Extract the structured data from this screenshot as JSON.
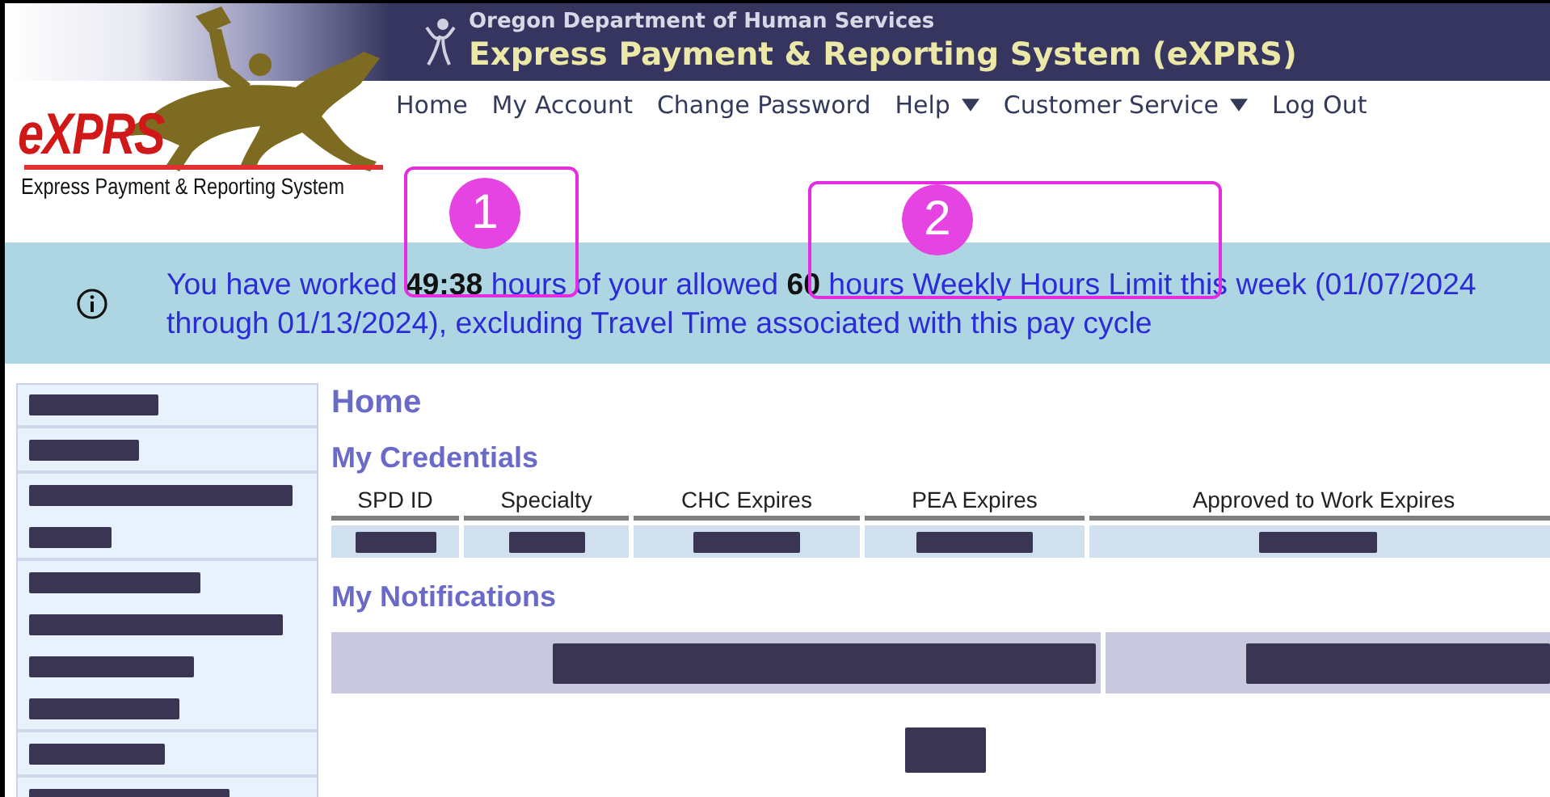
{
  "header": {
    "agency": "Oregon Department of Human Services",
    "system_title": "Express Payment & Reporting System (eXPRS)"
  },
  "logo": {
    "wordmark": "eXPRS",
    "tagline": "Express Payment & Reporting System"
  },
  "nav": [
    {
      "label": "Home",
      "kind": "link"
    },
    {
      "label": "My Account",
      "kind": "link"
    },
    {
      "label": "Change Password",
      "kind": "link"
    },
    {
      "label": "Help",
      "kind": "menu"
    },
    {
      "label": "Customer Service",
      "kind": "menu"
    },
    {
      "label": "Log Out",
      "kind": "link"
    }
  ],
  "annotations": [
    {
      "number": "1"
    },
    {
      "number": "2"
    }
  ],
  "banner": {
    "message": "You have worked **49:38** hours of your allowed **60** hours Weekly Hours Limit this week (01/07/2024 through 01/13/2024), excluding Travel Time associated with this pay cycle"
  },
  "sidebar": {
    "groups": [
      {
        "items": [
          {
            "kind": "redacted"
          }
        ]
      },
      {
        "items": [
          {
            "kind": "redacted"
          }
        ]
      },
      {
        "items": [
          {
            "kind": "redacted"
          },
          {
            "kind": "redacted"
          }
        ]
      },
      {
        "items": [
          {
            "kind": "redacted"
          },
          {
            "kind": "redacted"
          },
          {
            "kind": "redacted"
          },
          {
            "kind": "redacted"
          }
        ]
      },
      {
        "items": [
          {
            "kind": "redacted"
          }
        ]
      },
      {
        "items": [
          {
            "kind": "redacted"
          }
        ]
      }
    ]
  },
  "page_title": "Home",
  "credentials": {
    "heading": "My Credentials",
    "columns": [
      "SPD ID",
      "Specialty",
      "CHC Expires",
      "PEA Expires",
      "Approved to Work Expires"
    ],
    "rows": [
      {
        "cells": [
          {
            "kind": "redacted"
          },
          {
            "kind": "redacted"
          },
          {
            "kind": "redacted"
          },
          {
            "kind": "redacted"
          },
          {
            "kind": "redacted"
          }
        ]
      }
    ]
  },
  "notifications": {
    "heading": "My Notifications",
    "rows": [
      {
        "cells": [
          {
            "kind": "redacted"
          },
          {
            "kind": "redacted"
          }
        ]
      }
    ],
    "button": {
      "kind": "redacted"
    }
  }
}
